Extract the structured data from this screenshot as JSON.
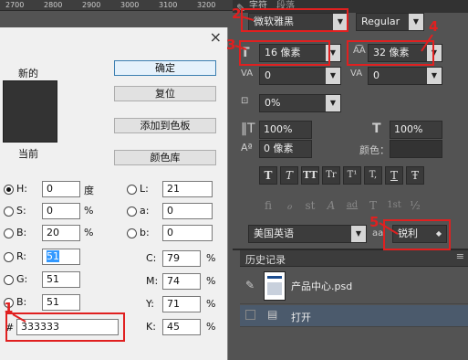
{
  "ruler": {
    "ticks": [
      "2700",
      "2800",
      "2900",
      "3000",
      "3100",
      "3200"
    ]
  },
  "color_picker": {
    "close_glyph": "×",
    "new_label": "新的",
    "current_label": "当前",
    "new_color": "#333333",
    "current_color": "#333333",
    "buttons": {
      "ok": "确定",
      "reset": "复位",
      "add_swatch": "添加到色板",
      "color_lib": "颜色库"
    },
    "hsb": [
      {
        "label": "H:",
        "value": "0",
        "unit": "度"
      },
      {
        "label": "S:",
        "value": "0",
        "unit": "%"
      },
      {
        "label": "B:",
        "value": "20",
        "unit": "%"
      }
    ],
    "lab": [
      {
        "label": "L:",
        "value": "21"
      },
      {
        "label": "a:",
        "value": "0"
      },
      {
        "label": "b:",
        "value": "0"
      }
    ],
    "rgb": [
      {
        "label": "R:",
        "value": "51"
      },
      {
        "label": "G:",
        "value": "51"
      },
      {
        "label": "B:",
        "value": "51"
      }
    ],
    "cmyk": [
      {
        "label": "C:",
        "value": "79",
        "unit": "%"
      },
      {
        "label": "M:",
        "value": "74",
        "unit": "%"
      },
      {
        "label": "Y:",
        "value": "71",
        "unit": "%"
      },
      {
        "label": "K:",
        "value": "45",
        "unit": "%"
      }
    ],
    "hex_label": "#",
    "hex_value": "333333"
  },
  "character_panel": {
    "tabs": [
      "字符",
      "段落"
    ],
    "font_family": "微软雅黑",
    "font_style": "Regular",
    "font_size": "16 像素",
    "leading": "32 像素",
    "kerning": "0",
    "tracking": "0",
    "scale_pct": "0%",
    "vertical_scale": "100%",
    "horizontal_scale": "100%",
    "baseline_shift": "0 像素",
    "color_label": "颜色：",
    "style_buttons": [
      "T",
      "T",
      "TT",
      "Tr",
      "T¹",
      "T,",
      "T",
      "Ŧ"
    ],
    "opentype_buttons": [
      "fi",
      "ℴ",
      "st",
      "A",
      "ad",
      "T",
      "1st",
      "½"
    ],
    "language": "美国英语",
    "aa_icon": "aa",
    "antialias": "锐利"
  },
  "history_panel": {
    "title": "历史记录",
    "snapshot": "产品中心.psd",
    "step": "打开"
  },
  "annotations": {
    "n1": "1",
    "n2": "2",
    "n3": "3",
    "n4": "4",
    "n5": "5"
  }
}
